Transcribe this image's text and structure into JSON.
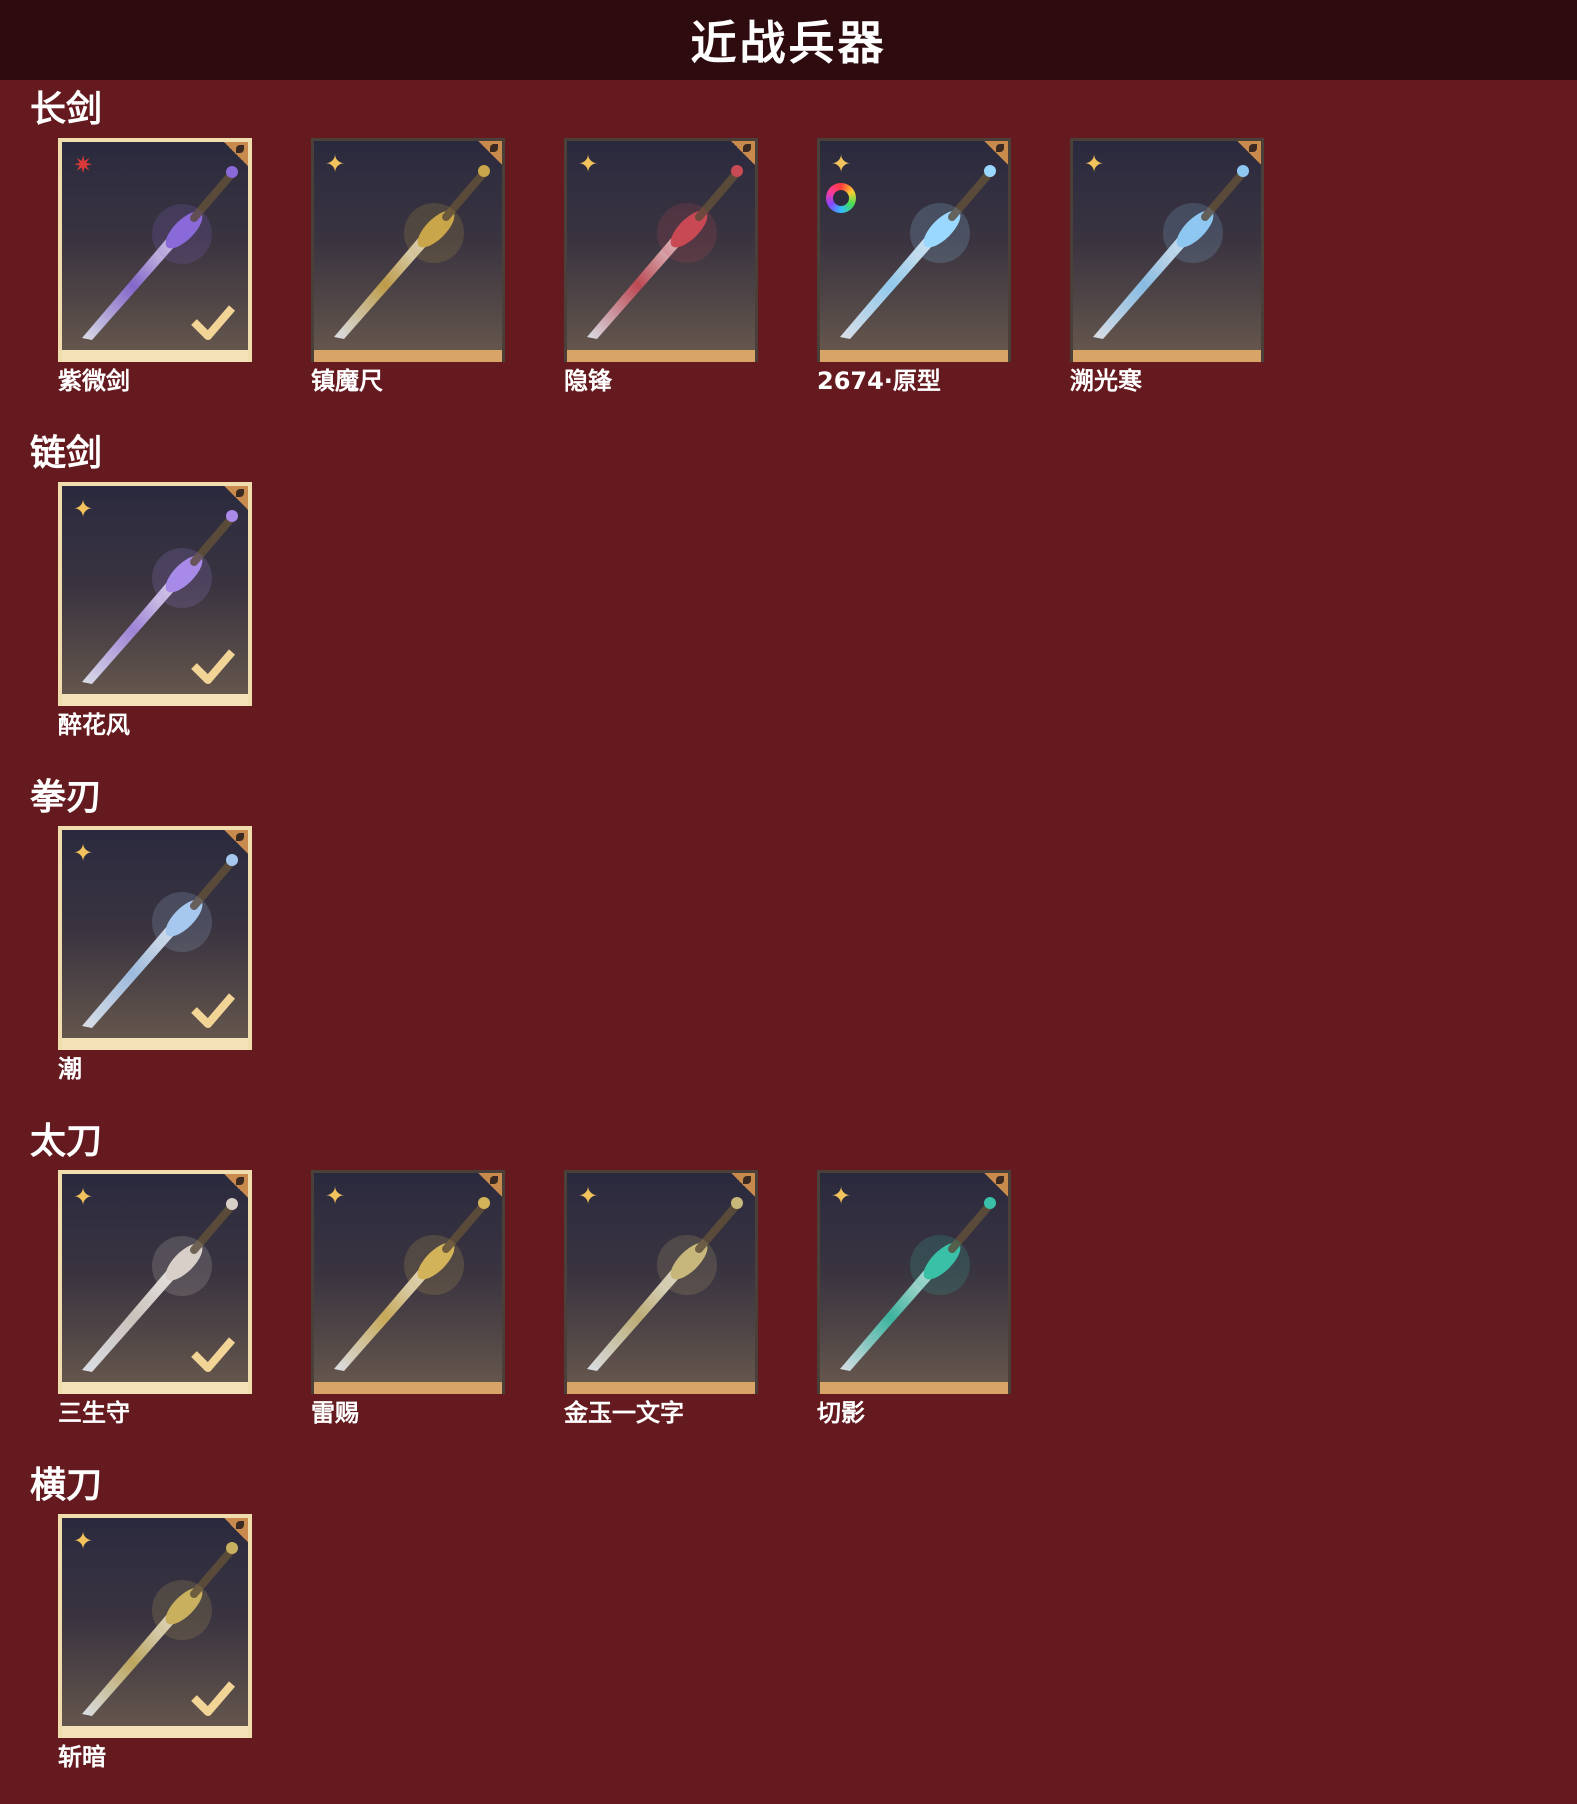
{
  "page": {
    "title": "近战兵器"
  },
  "sections": [
    {
      "title": "长剑",
      "items": [
        {
          "name": "紫微剑",
          "owned": true,
          "rarity_icon": "red-star-icon",
          "weapon_color": "#8a6ad8"
        },
        {
          "name": "镇魔尺",
          "owned": false,
          "rarity_icon": "gold-shuriken-icon",
          "weapon_color": "#c9a64a"
        },
        {
          "name": "隐锋",
          "owned": false,
          "rarity_icon": "gold-shuriken-icon",
          "weapon_color": "#c84a55"
        },
        {
          "name": "2674·原型",
          "owned": false,
          "rarity_icon": "gold-shuriken-icon",
          "weapon_color": "#9ad8ff",
          "color_variant": true
        },
        {
          "name": "溯光寒",
          "owned": false,
          "rarity_icon": "gold-shuriken-icon",
          "weapon_color": "#8ec8f2"
        }
      ]
    },
    {
      "title": "链剑",
      "items": [
        {
          "name": "醉花风",
          "owned": true,
          "rarity_icon": "gold-shuriken-icon",
          "weapon_color": "#a98ae8"
        }
      ]
    },
    {
      "title": "拳刃",
      "items": [
        {
          "name": "潮",
          "owned": true,
          "rarity_icon": "gold-shuriken-icon",
          "weapon_color": "#a6c8ee"
        }
      ]
    },
    {
      "title": "太刀",
      "items": [
        {
          "name": "三生守",
          "owned": true,
          "rarity_icon": "gold-shuriken-icon",
          "weapon_color": "#d8d0c8"
        },
        {
          "name": "雷赐",
          "owned": false,
          "rarity_icon": "gold-shuriken-icon",
          "weapon_color": "#d4b45a"
        },
        {
          "name": "金玉一文字",
          "owned": false,
          "rarity_icon": "gold-shuriken-icon",
          "weapon_color": "#c8b87a"
        },
        {
          "name": "切影",
          "owned": false,
          "rarity_icon": "gold-shuriken-icon",
          "weapon_color": "#3ac0a8"
        }
      ]
    },
    {
      "title": "横刀",
      "items": [
        {
          "name": "斩暗",
          "owned": true,
          "rarity_icon": "gold-shuriken-icon",
          "weapon_color": "#c8b060"
        }
      ]
    }
  ],
  "colors": {
    "background": "#641a1e",
    "header": "#2e0b0e",
    "owned_border": "#f1dcae",
    "card_bar": "#d8a468"
  }
}
